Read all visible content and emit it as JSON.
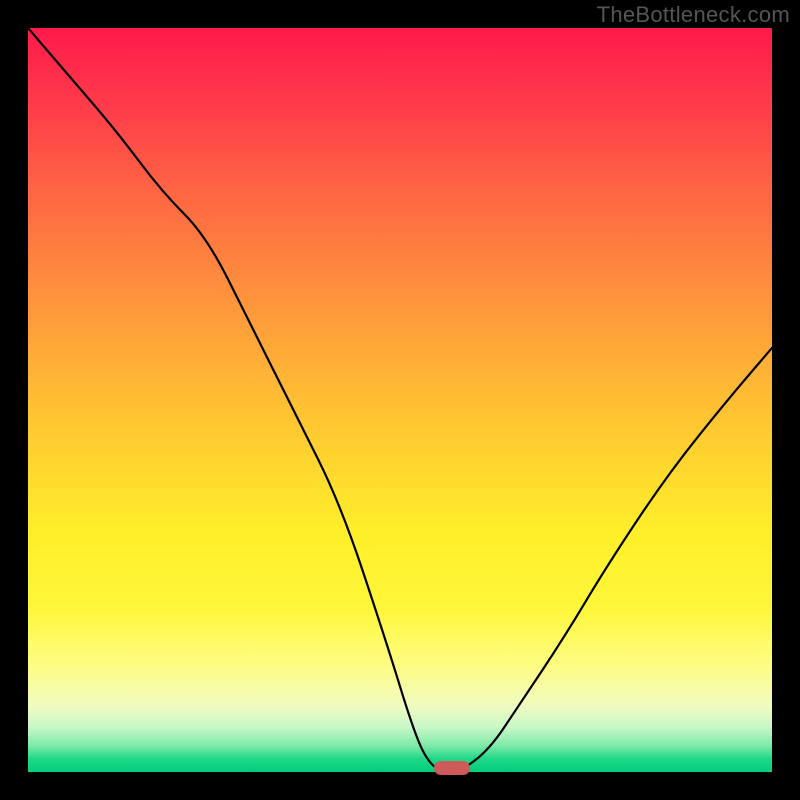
{
  "watermark": "TheBottleneck.com",
  "colors": {
    "frame_bg": "#000000",
    "marker": "#cf5a5a",
    "curve": "#000000",
    "gradient_top": "#ff1a4b",
    "gradient_bottom": "#00cf7a"
  },
  "chart_data": {
    "type": "line",
    "title": "",
    "xlabel": "",
    "ylabel": "",
    "xlim": [
      0,
      100
    ],
    "ylim": [
      0,
      100
    ],
    "x": [
      0,
      6,
      12,
      18,
      24,
      30,
      36,
      42,
      48,
      52,
      54,
      56,
      58,
      62,
      66,
      72,
      78,
      86,
      94,
      100
    ],
    "values": [
      100,
      93,
      86,
      78,
      72,
      60,
      48,
      36,
      18,
      5,
      1,
      0,
      0,
      3,
      9,
      18,
      28,
      40,
      50,
      57
    ],
    "optimum_x": 57,
    "optimum_y": 0,
    "annotations": []
  }
}
